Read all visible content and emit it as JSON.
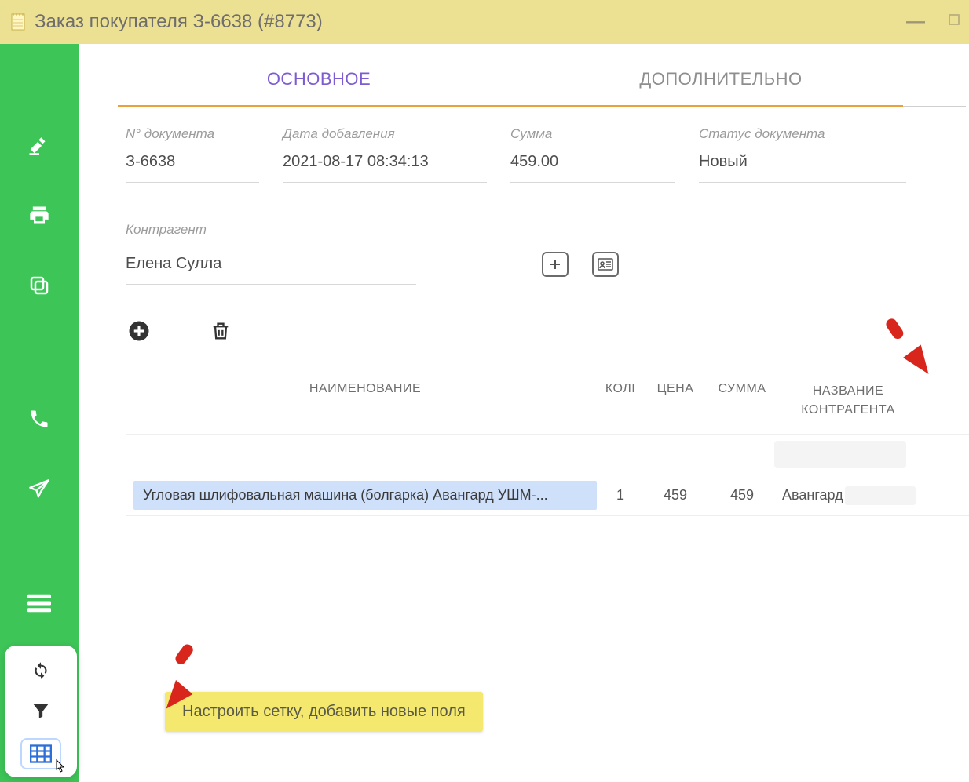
{
  "window": {
    "title": "Заказ покупателя З-6638 (#8773)"
  },
  "tabs": {
    "main": "ОСНОВНОЕ",
    "extra": "ДОПОЛНИТЕЛЬНО"
  },
  "fields": {
    "doc_no_label": "N° документа",
    "doc_no": "З-6638",
    "date_label": "Дата добавления",
    "date": "2021-08-17 08:34:13",
    "sum_label": "Сумма",
    "sum": "459.00",
    "status_label": "Статус документа",
    "status": "Новый",
    "contragent_label": "Контрагент",
    "contragent": "Елена Сулла"
  },
  "table": {
    "headers": {
      "name": "НАИМЕНОВАНИЕ",
      "qty": "КОЛІ",
      "price": "ЦЕНА",
      "sum": "СУММА",
      "counterparty_name": "НАЗВАНИЕ КОНТРАГЕНТА"
    },
    "rows": [
      {
        "name": "Угловая шлифовальная машина (болгарка) Авангард УШМ-...",
        "qty": "1",
        "price": "459",
        "sum": "459",
        "counterparty": "Авангард"
      }
    ]
  },
  "tooltip": "Настроить сетку, добавить новые поля",
  "sidebar_icons": {
    "auction": "auction-icon",
    "print": "print-icon",
    "copy": "copy-icon",
    "phone": "phone-icon",
    "send": "send-icon",
    "menu": "menu-icon"
  },
  "float_icons": {
    "refresh": "refresh-icon",
    "filter": "filter-icon",
    "grid": "grid-icon"
  }
}
